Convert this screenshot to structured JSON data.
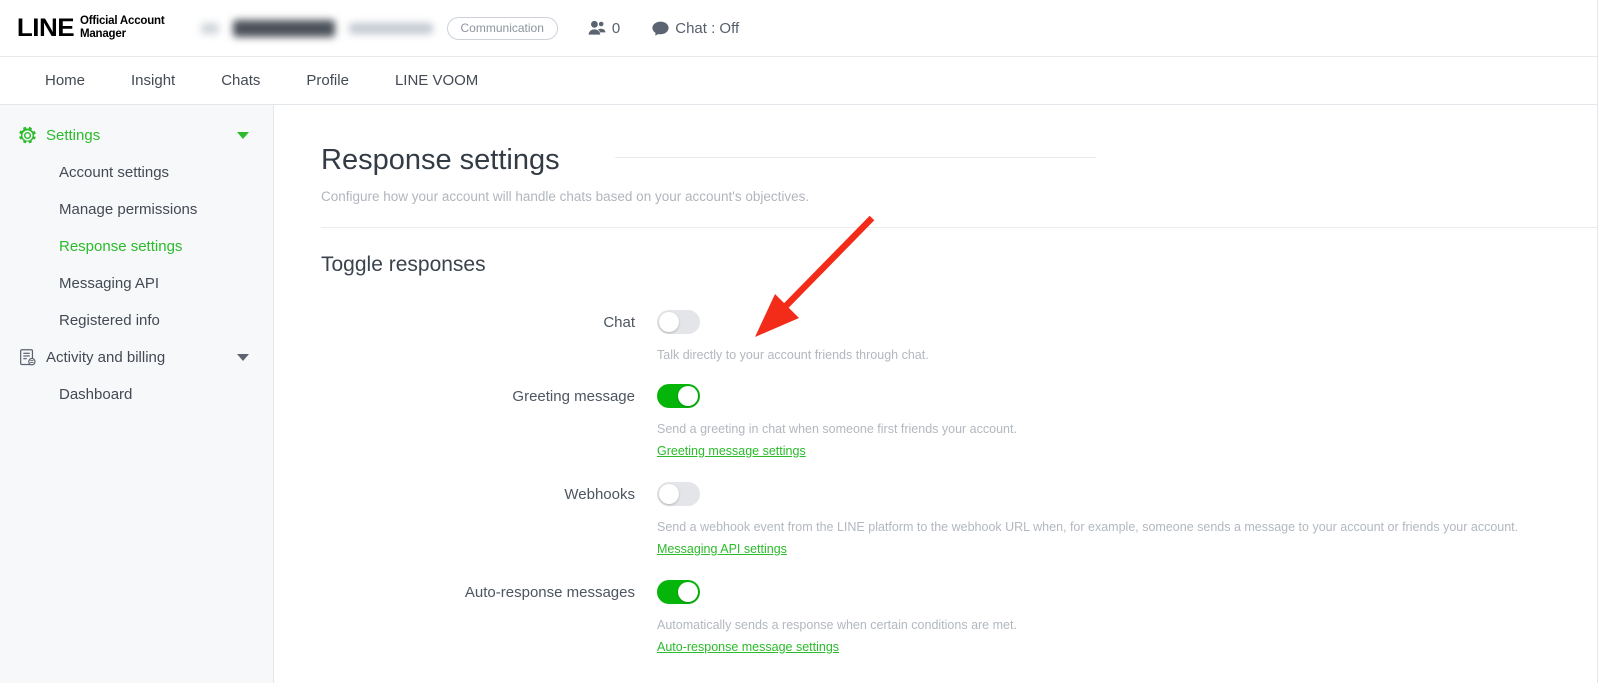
{
  "header": {
    "logo_main": "LINE",
    "logo_sub_line1": "Official Account",
    "logo_sub_line2": "Manager",
    "account_badge": "Communication",
    "friend_count": "0",
    "chat_status": "Chat : Off",
    "friends_icon": "friends-icon",
    "chat_icon": "chat-bubble-icon"
  },
  "nav": {
    "tabs": [
      {
        "label": "Home"
      },
      {
        "label": "Insight"
      },
      {
        "label": "Chats"
      },
      {
        "label": "Profile"
      },
      {
        "label": "LINE VOOM"
      }
    ]
  },
  "sidebar": {
    "groups": [
      {
        "label": "Settings",
        "icon": "gear-icon",
        "expanded": true,
        "items": [
          {
            "label": "Account settings",
            "selected": false
          },
          {
            "label": "Manage permissions",
            "selected": false
          },
          {
            "label": "Response settings",
            "selected": true
          },
          {
            "label": "Messaging API",
            "selected": false
          },
          {
            "label": "Registered info",
            "selected": false
          }
        ]
      },
      {
        "label": "Activity and billing",
        "icon": "document-list-icon",
        "expanded": true,
        "items": [
          {
            "label": "Dashboard",
            "selected": false
          }
        ]
      }
    ]
  },
  "main": {
    "title": "Response settings",
    "subtitle": "Configure how your account will handle chats based on your account's objectives.",
    "section_title": "Toggle responses",
    "rows": [
      {
        "label": "Chat",
        "state": "off",
        "description": "Talk directly to your account friends through chat.",
        "link": null
      },
      {
        "label": "Greeting message",
        "state": "on",
        "description": "Send a greeting in chat when someone first friends your account.",
        "link": "Greeting message settings"
      },
      {
        "label": "Webhooks",
        "state": "off",
        "description": "Send a webhook event from the LINE platform to the webhook URL when, for example, someone sends a message to your account or friends your account.",
        "link": "Messaging API settings"
      },
      {
        "label": "Auto-response messages",
        "state": "on",
        "description": "Automatically sends a response when certain conditions are met.",
        "link": "Auto-response message settings"
      }
    ]
  },
  "annotation": {
    "type": "red-arrow",
    "color": "#f22c18",
    "points_to": "chat-toggle-switch"
  },
  "colors": {
    "line_green": "#06c755",
    "toggle_on": "#06b50a",
    "toggle_off": "#e3e5e8",
    "sidebar_bg": "#f7f8f9",
    "annotation_red": "#f22c18"
  }
}
